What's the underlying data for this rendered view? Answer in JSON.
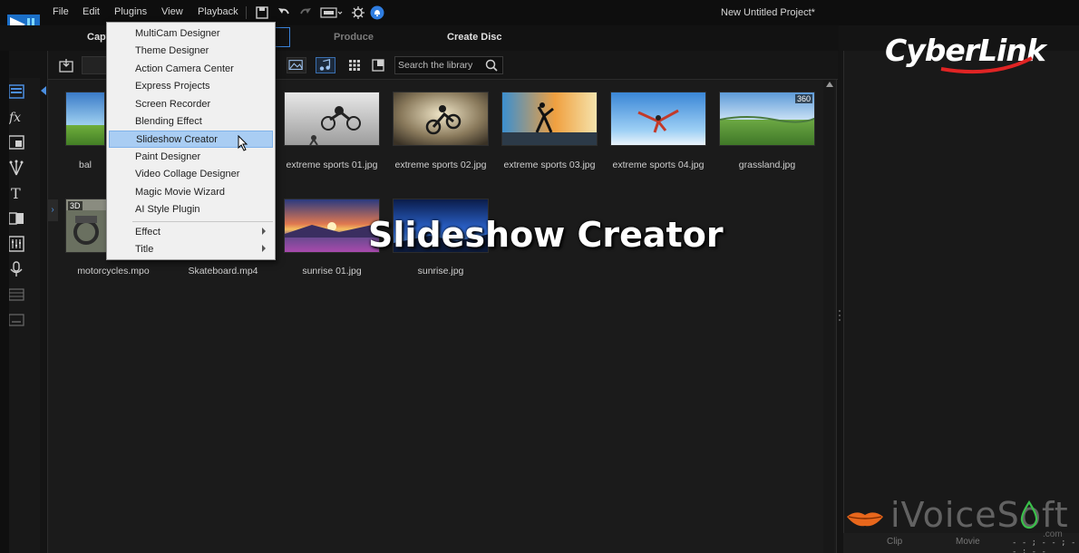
{
  "menubar": {
    "items": [
      "File",
      "Edit",
      "Plugins",
      "View",
      "Playback"
    ],
    "project_title": "New Untitled Project*"
  },
  "modes": {
    "capture": "Capt",
    "produce": "Produce",
    "create_disc": "Create Disc"
  },
  "library": {
    "search_placeholder": "Search the library",
    "items": [
      {
        "label": "bal",
        "badge": ""
      },
      {
        "label": "extreme sports 01.jpg",
        "badge": ""
      },
      {
        "label": "extreme sports 02.jpg",
        "badge": ""
      },
      {
        "label": "extreme sports 03.jpg",
        "badge": ""
      },
      {
        "label": "extreme sports 04.jpg",
        "badge": ""
      },
      {
        "label": "grassland.jpg",
        "badge": "360"
      },
      {
        "label": "motorcycles.mpo",
        "badge": "3D"
      },
      {
        "label": "Skateboard.mp4",
        "badge": ""
      },
      {
        "label": "sunrise 01.jpg",
        "badge": ""
      },
      {
        "label": "sunrise.jpg",
        "badge": ""
      }
    ]
  },
  "plugins_menu": {
    "items": [
      "MultiCam Designer",
      "Theme Designer",
      "Action Camera Center",
      "Express Projects",
      "Screen Recorder",
      "Blending Effect",
      "Slideshow Creator",
      "Paint Designer",
      "Video Collage Designer",
      "Magic Movie Wizard",
      "AI Style Plugin"
    ],
    "selected": "Slideshow Creator",
    "submenus": [
      "Effect",
      "Title"
    ]
  },
  "caption": "Slideshow Creator",
  "brand": "CyberLink",
  "watermark": {
    "text": "iVoiceSoft",
    "sub": ".com"
  },
  "preview": {
    "clip_label": "Clip",
    "movie_label": "Movie",
    "timecode": "- - ; - - ; - - ; - -"
  },
  "colors": {
    "accent": "#3a82d8",
    "selected_item": "#a9cdf3",
    "brand_swoosh": "#e02424"
  }
}
